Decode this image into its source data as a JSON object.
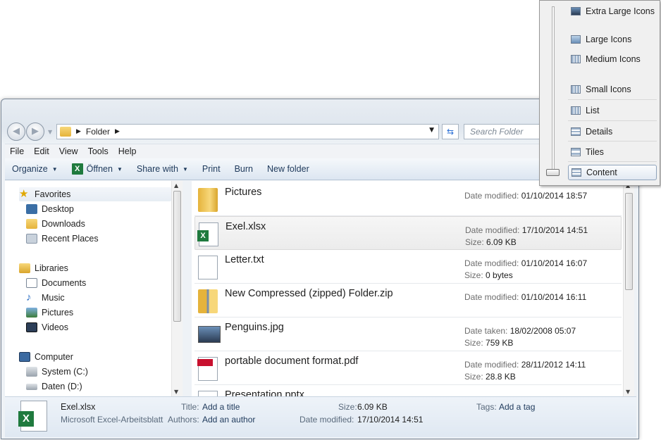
{
  "address": {
    "crumb": "Folder",
    "search_placeholder": "Search Folder"
  },
  "menubar": [
    "File",
    "Edit",
    "View",
    "Tools",
    "Help"
  ],
  "commands": {
    "organize": "Organize",
    "open": "Öffnen",
    "share": "Share with",
    "print": "Print",
    "burn": "Burn",
    "new_folder": "New folder"
  },
  "nav": {
    "favorites": "Favorites",
    "desktop": "Desktop",
    "downloads": "Downloads",
    "recent": "Recent Places",
    "libraries": "Libraries",
    "documents": "Documents",
    "music": "Music",
    "pictures": "Pictures",
    "videos": "Videos",
    "computer": "Computer",
    "system": "System (C:)",
    "daten": "Daten (D:)"
  },
  "files": [
    {
      "name": "Pictures",
      "m1_label": "Date modified:",
      "m1_value": "01/10/2014 18:57",
      "m2_label": "",
      "m2_value": "",
      "icon": "folder-icon"
    },
    {
      "name": "Exel.xlsx",
      "m1_label": "Date modified:",
      "m1_value": "17/10/2014 14:51",
      "m2_label": "Size:",
      "m2_value": "6.09 KB",
      "icon": "excel-file-icon"
    },
    {
      "name": "Letter.txt",
      "m1_label": "Date modified:",
      "m1_value": "01/10/2014 16:07",
      "m2_label": "Size:",
      "m2_value": "0 bytes",
      "icon": "text-file-icon"
    },
    {
      "name": "New Compressed (zipped) Folder.zip",
      "m1_label": "Date modified:",
      "m1_value": "01/10/2014 16:11",
      "m2_label": "",
      "m2_value": "",
      "icon": "zip-folder-icon"
    },
    {
      "name": "Penguins.jpg",
      "m1_label": "Date taken:",
      "m1_value": "18/02/2008 05:07",
      "m2_label": "Size:",
      "m2_value": "759 KB",
      "icon": "image-file-icon"
    },
    {
      "name": "portable document format.pdf",
      "m1_label": "Date modified:",
      "m1_value": "28/11/2012 14:11",
      "m2_label": "Size:",
      "m2_value": "28.8 KB",
      "icon": "pdf-file-icon"
    },
    {
      "name": "Presentation.pptx",
      "m1_label": "",
      "m1_value": "",
      "m2_label": "",
      "m2_value": "",
      "icon": "presentation-file-icon"
    }
  ],
  "details": {
    "name": "Exel.xlsx",
    "type": "Microsoft Excel-Arbeitsblatt",
    "title_label": "Title:",
    "title_value": "Add a title",
    "authors_label": "Authors:",
    "authors_value": "Add an author",
    "size_label": "Size:",
    "size_value": "6.09 KB",
    "modified_label": "Date modified:",
    "modified_value": "17/10/2014 14:51",
    "tags_label": "Tags:",
    "tags_value": "Add a tag"
  },
  "view_menu": {
    "extra_large": "Extra Large Icons",
    "large": "Large Icons",
    "medium": "Medium Icons",
    "small": "Small Icons",
    "list": "List",
    "details": "Details",
    "tiles": "Tiles",
    "content": "Content",
    "selected": "Content"
  },
  "colors": {
    "accent": "#1e395b",
    "excel_green": "#1f7a3e",
    "folder_yellow": "#e5b33b",
    "pdf_red": "#c8102e"
  }
}
